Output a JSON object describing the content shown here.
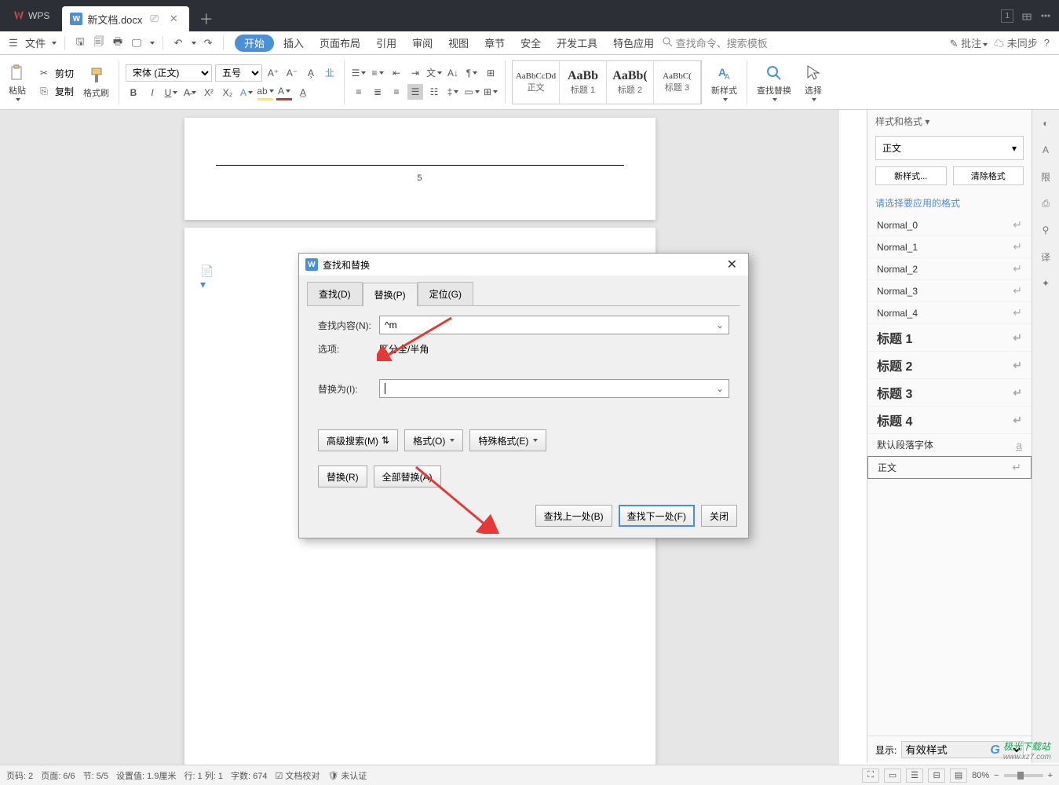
{
  "titlebar": {
    "app_name": "WPS",
    "doc_name": "新文档.docx",
    "counter": "1"
  },
  "menubar": {
    "file": "文件",
    "items": [
      "开始",
      "插入",
      "页面布局",
      "引用",
      "审阅",
      "视图",
      "章节",
      "安全",
      "开发工具",
      "特色应用"
    ],
    "search_placeholder": "查找命令、搜索模板",
    "right": {
      "annotate": "批注",
      "unsynced": "未同步"
    }
  },
  "ribbon": {
    "paste": "粘贴",
    "cut": "剪切",
    "copy": "复制",
    "format_painter": "格式刷",
    "font": "宋体 (正文)",
    "size": "五号",
    "styles": [
      {
        "preview": "AaBbCcDd",
        "name": "正文"
      },
      {
        "preview": "AaBb",
        "name": "标题 1"
      },
      {
        "preview": "AaBb(",
        "name": "标题 2"
      },
      {
        "preview": "AaBbC(",
        "name": "标题 3"
      }
    ],
    "new_style": "新样式",
    "find_replace": "查找替换",
    "select": "选择"
  },
  "page": {
    "number": "5"
  },
  "side": {
    "title": "样式和格式",
    "current": "正文",
    "new_style": "新样式...",
    "clear": "清除格式",
    "hint": "请选择要应用的格式",
    "list": [
      "Normal_0",
      "Normal_1",
      "Normal_2",
      "Normal_3",
      "Normal_4",
      "标题 1",
      "标题 2",
      "标题 3",
      "标题 4",
      "默认段落字体",
      "正文"
    ],
    "show_label": "显示:",
    "show_value": "有效样式"
  },
  "dialog": {
    "title": "查找和替换",
    "tabs": [
      "查找(D)",
      "替换(P)",
      "定位(G)"
    ],
    "find_label": "查找内容(N):",
    "find_value": "^m",
    "opt_label": "选项:",
    "opt_value": "区分全/半角",
    "repl_label": "替换为(I):",
    "repl_value": "",
    "adv": "高级搜索(M)",
    "fmt": "格式(O)",
    "special": "特殊格式(E)",
    "replace": "替换(R)",
    "replace_all": "全部替换(A)",
    "prev": "查找上一处(B)",
    "next": "查找下一处(F)",
    "close": "关闭"
  },
  "status": {
    "page": "页码: 2",
    "pages": "页面: 6/6",
    "section": "节: 5/5",
    "setting": "设置值: 1.9厘米",
    "line": "行: 1 列: 1",
    "words": "字数: 674",
    "proof": "文档校对",
    "auth": "未认证",
    "zoom": "80%"
  },
  "watermark": {
    "text": "极光下载站",
    "url": "www.xz7.com"
  }
}
